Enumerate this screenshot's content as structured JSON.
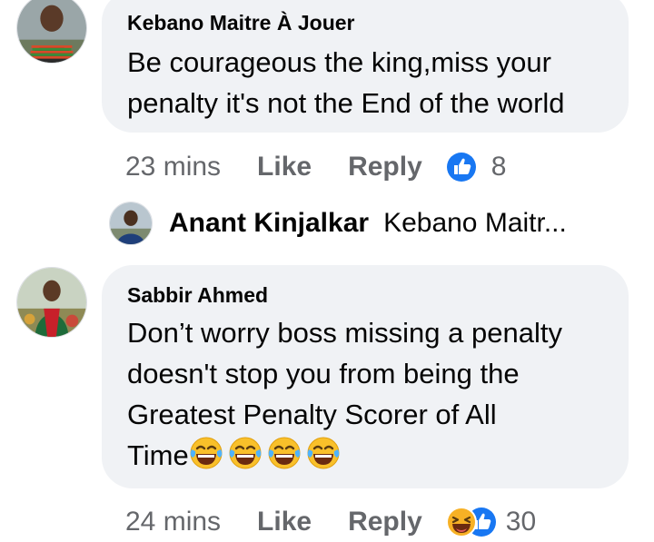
{
  "comments": [
    {
      "author": "Kebano Maitre À Jouer",
      "text_lines": [
        "Be courageous the king,miss your",
        "penalty it's not the End of the world"
      ],
      "time": "23 mins",
      "like_label": "Like",
      "reply_label": "Reply",
      "reaction_icons": [
        "like-icon"
      ],
      "reaction_count": "8",
      "reply_preview": {
        "author": "Anant Kinjalkar",
        "text": "Kebano Maitr..."
      }
    },
    {
      "author": "Sabbir Ahmed",
      "text_lines": [
        "Don’t worry boss missing a penalty",
        "doesn't stop you from being the",
        "Greatest Penalty Scorer of All",
        "Time"
      ],
      "emojis": [
        "😂",
        "😂",
        "😂",
        "😂"
      ],
      "time": "24 mins",
      "like_label": "Like",
      "reply_label": "Reply",
      "reaction_icons": [
        "haha-icon",
        "like-icon"
      ],
      "reaction_count": "30"
    }
  ],
  "colors": {
    "bubble": "#f0f2f5",
    "text": "#050505",
    "meta": "#65676b",
    "like_blue": "#1877f2",
    "haha_yellow": "#f7b125"
  }
}
